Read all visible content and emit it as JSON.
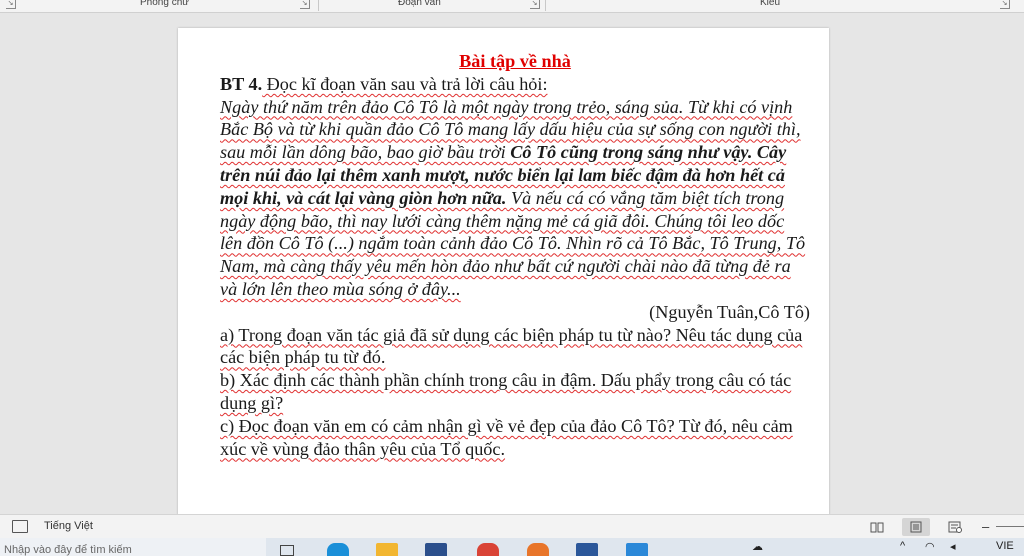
{
  "ribbon": {
    "groups": [
      "Phông chữ",
      "Đoạn văn",
      "Kiểu"
    ]
  },
  "document": {
    "title": "Bài  tập về nhà",
    "exercise_label": "BT 4.",
    "exercise_prompt": " Đọc kĩ đoạn văn sau và trả lời câu hỏi:",
    "passage_part1": "Ngày thứ năm trên đảo Cô Tô là một ngày trong trẻo, sáng sủa. Từ khi có vịnh Bắc Bộ và từ khi quần đảo Cô Tô mang lấy dấu hiệu của sự sống con người thì, sau mỗi lần dông bão, bao giờ bầu trời ",
    "passage_bold": "Cô Tô cũng trong sáng như vậy. Cây trên núi đảo lại thêm xanh mượt, nước biển lại lam biếc đậm đà hơn hết cả mọi khi, và cát lại vàng giòn hơn nữa.",
    "passage_part2": " Và nếu cá có vắng tăm biệt tích trong ngày động bão, thì nay lưới càng thêm nặng mẻ cá giã đôi. Chúng tôi leo dốc lên đồn Cô Tô (...) ngắm toàn cảnh đảo Cô Tô. Nhìn rõ cả Tô Bắc, Tô Trung, Tô Nam, mà càng thấy yêu mến hòn đảo như bất cứ người chài nào đã từng đẻ ra và lớn lên theo mùa sóng ở đây...",
    "source": "(Nguyễn Tuân,Cô Tô)",
    "question_a": "a) Trong đoạn văn tác giả đã sử dụng các biện pháp tu từ nào? Nêu tác dụng của các biện pháp tu từ đó.",
    "question_b": "b) Xác định các thành phần chính trong câu in đậm. Dấu phẩy trong câu có tác dụng gì?",
    "question_c": "c) Đọc đoạn văn em có cảm nhận gì về vẻ đẹp của đảo Cô Tô? Từ đó, nêu cảm xúc về vùng đảo thân yêu của Tổ quốc."
  },
  "statusbar": {
    "language": "Tiếng Việt"
  },
  "taskbar": {
    "search_text": "Nhập vào đây để tìm kiếm",
    "tray_lang": "VIE"
  },
  "colors": {
    "title_red": "#e00000",
    "spell_squiggle": "#e03030"
  }
}
